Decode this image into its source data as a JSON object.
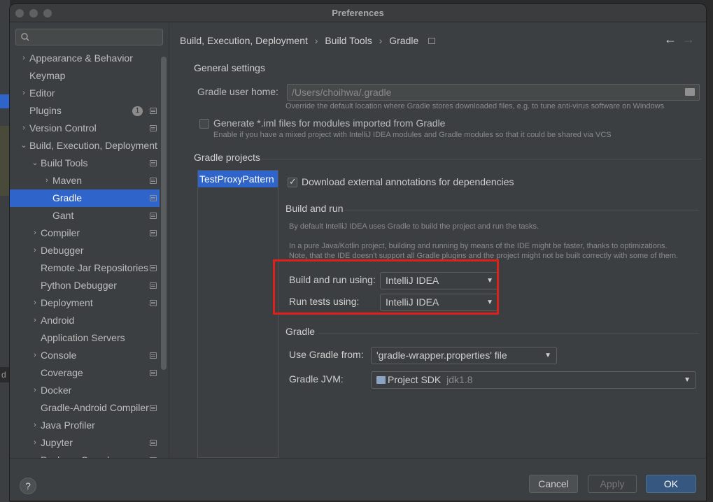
{
  "window": {
    "title": "Preferences"
  },
  "sidebar": {
    "items": [
      {
        "label": "Appearance & Behavior",
        "chevron": "›",
        "level": 0,
        "proj": false
      },
      {
        "label": "Keymap",
        "chevron": "",
        "level": 0,
        "proj": false
      },
      {
        "label": "Editor",
        "chevron": "›",
        "level": 0,
        "proj": false
      },
      {
        "label": "Plugins",
        "chevron": "",
        "level": 0,
        "proj": true,
        "badge": "1"
      },
      {
        "label": "Version Control",
        "chevron": "›",
        "level": 0,
        "proj": true
      },
      {
        "label": "Build, Execution, Deployment",
        "chevron": "⌄",
        "level": 0,
        "proj": false
      },
      {
        "label": "Build Tools",
        "chevron": "⌄",
        "level": 1,
        "proj": true
      },
      {
        "label": "Maven",
        "chevron": "›",
        "level": 2,
        "proj": true
      },
      {
        "label": "Gradle",
        "chevron": "",
        "level": 2,
        "proj": true,
        "selected": true
      },
      {
        "label": "Gant",
        "chevron": "",
        "level": 2,
        "proj": true
      },
      {
        "label": "Compiler",
        "chevron": "›",
        "level": 1,
        "proj": true
      },
      {
        "label": "Debugger",
        "chevron": "›",
        "level": 1,
        "proj": false
      },
      {
        "label": "Remote Jar Repositories",
        "chevron": "",
        "level": 1,
        "proj": true
      },
      {
        "label": "Python Debugger",
        "chevron": "",
        "level": 1,
        "proj": true
      },
      {
        "label": "Deployment",
        "chevron": "›",
        "level": 1,
        "proj": true
      },
      {
        "label": "Android",
        "chevron": "›",
        "level": 1,
        "proj": false
      },
      {
        "label": "Application Servers",
        "chevron": "",
        "level": 1,
        "proj": false
      },
      {
        "label": "Console",
        "chevron": "›",
        "level": 1,
        "proj": true
      },
      {
        "label": "Coverage",
        "chevron": "",
        "level": 1,
        "proj": true
      },
      {
        "label": "Docker",
        "chevron": "›",
        "level": 1,
        "proj": false
      },
      {
        "label": "Gradle-Android Compiler",
        "chevron": "",
        "level": 1,
        "proj": true
      },
      {
        "label": "Java Profiler",
        "chevron": "›",
        "level": 1,
        "proj": false
      },
      {
        "label": "Jupyter",
        "chevron": "›",
        "level": 1,
        "proj": true
      },
      {
        "label": "Package Search",
        "chevron": "",
        "level": 1,
        "proj": true
      }
    ]
  },
  "breadcrumb": {
    "parts": [
      "Build, Execution, Deployment",
      "Build Tools",
      "Gradle"
    ],
    "separator": "›",
    "back": "←",
    "forward": "→"
  },
  "general": {
    "title": "General settings",
    "user_home_label": "Gradle user home:",
    "user_home_value": "/Users/choihwa/.gradle",
    "user_home_hint": "Override the default location where Gradle stores downloaded files, e.g. to tune anti-virus software on Windows",
    "iml_label": "Generate *.iml files for modules imported from Gradle",
    "iml_hint": "Enable if you have a mixed project with IntelliJ IDEA modules and Gradle modules so that it could be shared via VCS"
  },
  "projects": {
    "title": "Gradle projects",
    "list": [
      "TestProxyPattern"
    ],
    "annotations_label": "Download external annotations for dependencies"
  },
  "build_run": {
    "title": "Build and run",
    "hint1": "By default IntelliJ IDEA uses Gradle to build the project and run the tasks.",
    "hint2": "In a pure Java/Kotlin project, building and running by means of the IDE might be faster, thanks to optimizations.",
    "hint3": "Note, that the IDE doesn't support all Gradle plugins and the project might not be built correctly with some of them.",
    "build_label": "Build and run using:",
    "build_value": "IntelliJ IDEA",
    "tests_label": "Run tests using:",
    "tests_value": "IntelliJ IDEA"
  },
  "gradle": {
    "title": "Gradle",
    "use_from_label": "Use Gradle from:",
    "use_from_value": "'gradle-wrapper.properties' file",
    "jvm_label": "Gradle JVM:",
    "jvm_value": "Project SDK",
    "jvm_version": "jdk1.8"
  },
  "footer": {
    "help": "?",
    "cancel": "Cancel",
    "apply": "Apply",
    "ok": "OK"
  },
  "colors": {
    "accent": "#2f65ca",
    "highlight": "#e0201b",
    "ok_button": "#365880"
  }
}
